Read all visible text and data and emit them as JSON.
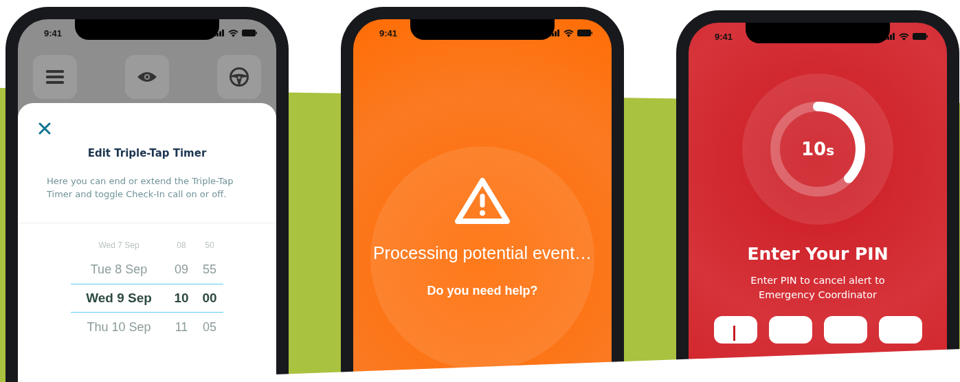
{
  "phones": [
    {
      "kind": "timer_editor",
      "status_time": "9:41",
      "sheet": {
        "title": "Edit Triple-Tap Timer",
        "description": "Here you can end or extend the Triple-Tap Timer and toggle Check-In call on or off.",
        "picker_rows": [
          {
            "date": "Wed 7 Sep",
            "hour": "08",
            "minute": "50",
            "selected": false
          },
          {
            "date": "Tue 8 Sep",
            "hour": "09",
            "minute": "55",
            "selected": false
          },
          {
            "date": "Wed 9 Sep",
            "hour": "10",
            "minute": "00",
            "selected": true
          },
          {
            "date": "Thu 10 Sep",
            "hour": "11",
            "minute": "05",
            "selected": false
          }
        ]
      }
    },
    {
      "kind": "processing",
      "status_time": "9:41",
      "message": "Processing potential event…",
      "question": "Do you need help?"
    },
    {
      "kind": "pin_entry",
      "status_time": "9:41",
      "countdown": {
        "value": "10",
        "unit": "s",
        "level": 0.37
      },
      "title": "Enter Your PIN",
      "subtitle": "Enter PIN to cancel alert to Emergency Coordinator",
      "pin_boxes": [
        {
          "focused": true
        },
        {
          "focused": false
        },
        {
          "focused": false
        },
        {
          "focused": false
        }
      ]
    }
  ]
}
